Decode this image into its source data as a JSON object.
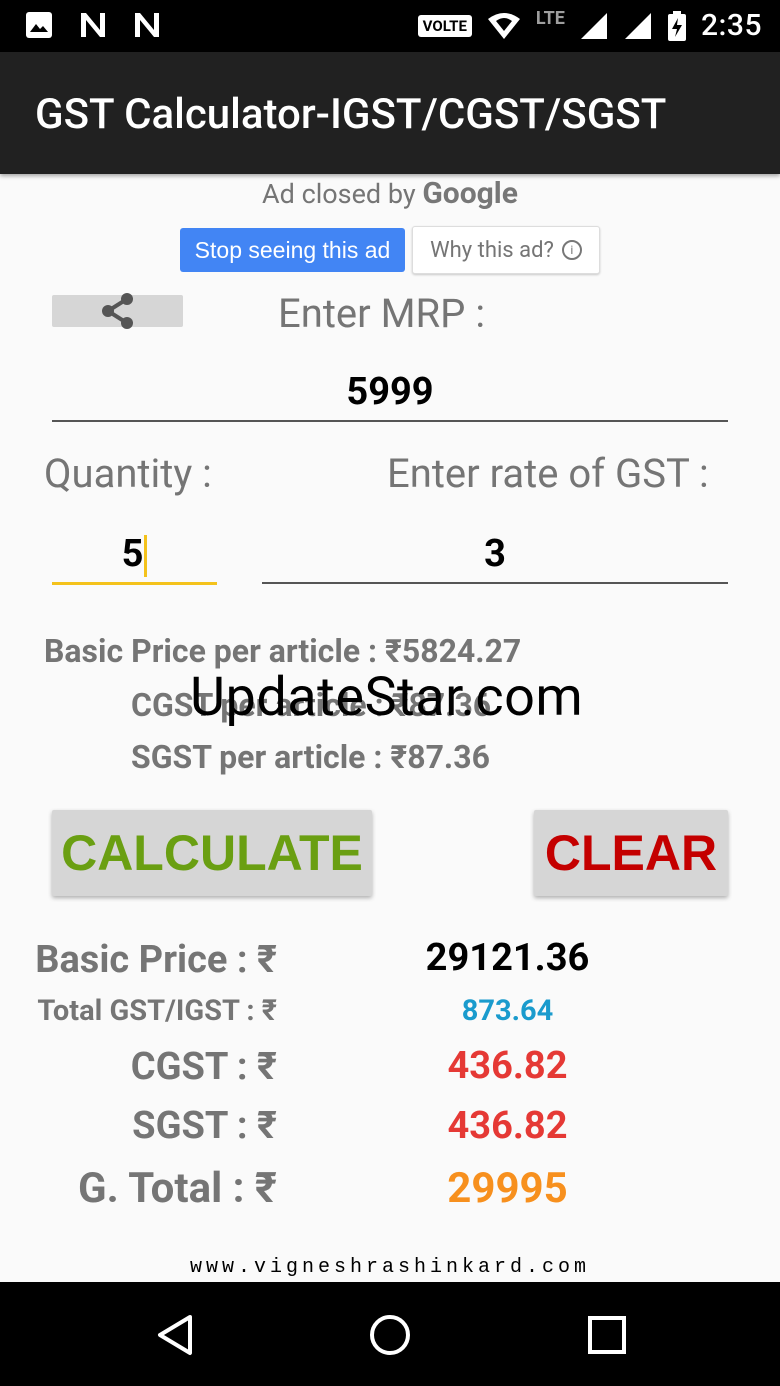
{
  "status_bar": {
    "time": "2:35",
    "volte": "VOLTE",
    "lte": "LTE"
  },
  "app_bar": {
    "title": "GST Calculator-IGST/CGST/SGST"
  },
  "ad": {
    "closed_by": "Ad closed by",
    "brand": "Google",
    "stop_label": "Stop seeing this ad",
    "why_label": "Why this ad?"
  },
  "form": {
    "mrp_label": "Enter MRP :",
    "mrp_value": "5999",
    "quantity_label": "Quantity :",
    "quantity_value": "5",
    "gst_rate_label": "Enter rate of GST :",
    "gst_rate_value": "3"
  },
  "per_article": {
    "basic": "Basic Price per article : ₹5824.27",
    "cgst": "CGST per article : ₹87.36",
    "sgst": "SGST per article : ₹87.36"
  },
  "watermark": "UpdateStar.com",
  "buttons": {
    "calculate": "CALCULATE",
    "clear": "CLEAR"
  },
  "results": {
    "basic_label": "Basic Price : ₹",
    "basic_value": "29121.36",
    "total_gst_label": "Total GST/IGST : ₹",
    "total_gst_value": "873.64",
    "cgst_label": "CGST : ₹",
    "cgst_value": "436.82",
    "sgst_label": "SGST : ₹",
    "sgst_value": "436.82",
    "grand_total_label": "G. Total : ₹",
    "grand_total_value": "29995"
  },
  "footer": {
    "url": "www.vigneshrashinkard.com"
  },
  "colors": {
    "calculate": "#6a9f12",
    "clear": "#c40000",
    "total_gst": "#1a9bcd",
    "cgst_sgst": "#e53935",
    "grand_total": "#f7901e",
    "ad_button": "#4285f4",
    "focus_underline": "#f4c21b"
  }
}
